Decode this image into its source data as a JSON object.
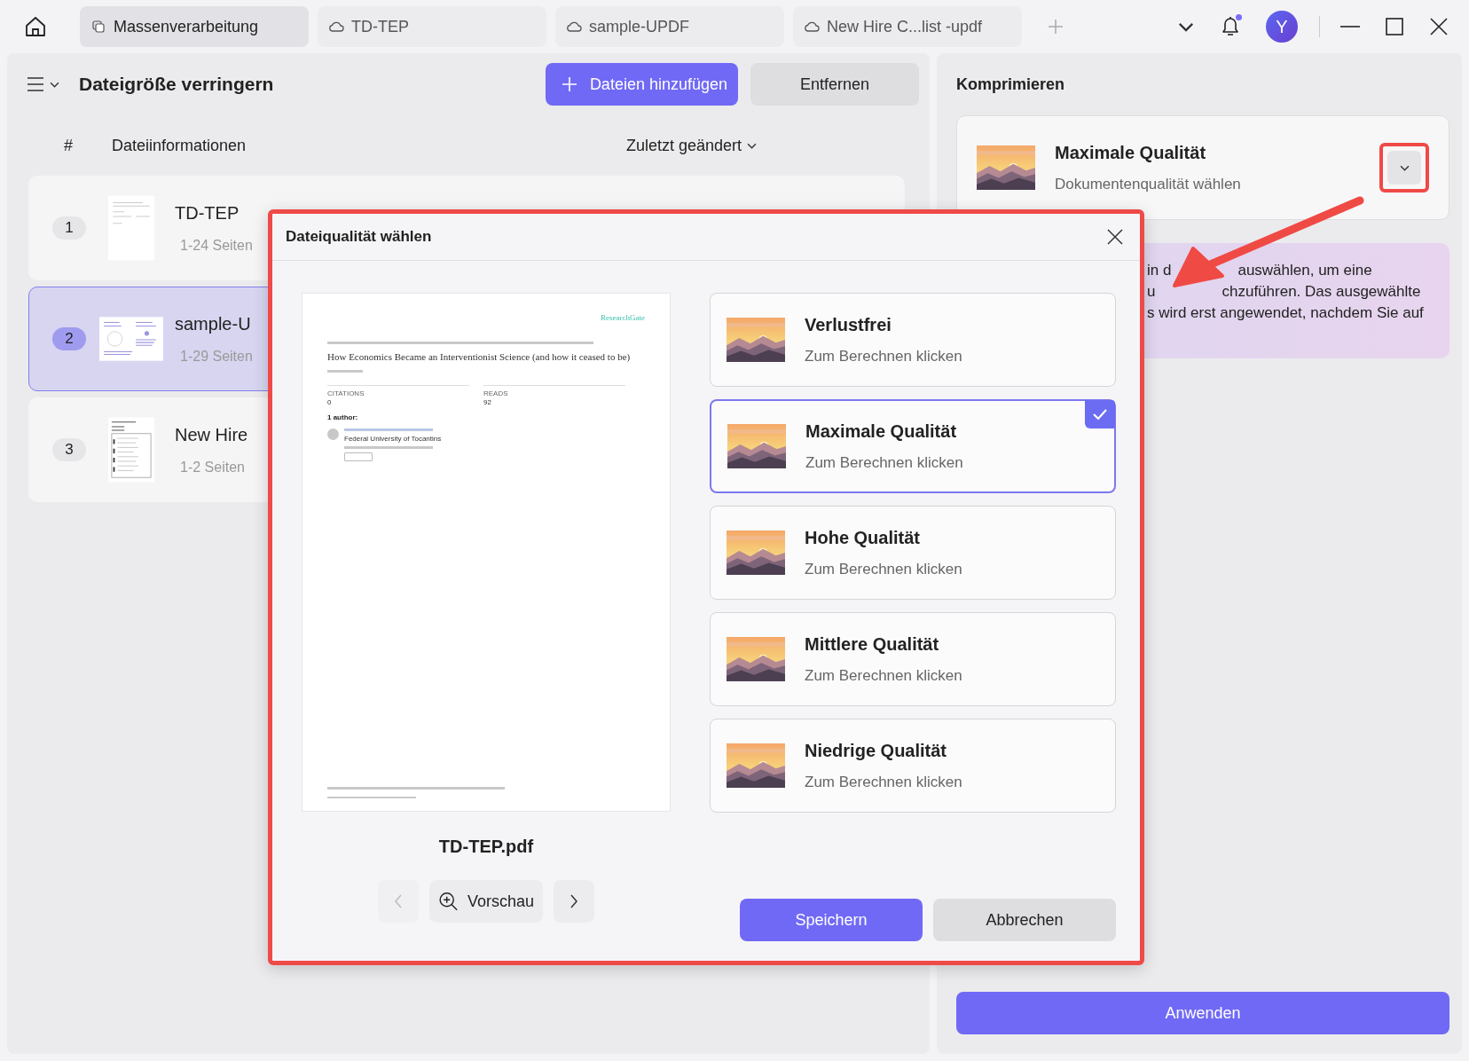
{
  "tabs": [
    {
      "label": "Massenverarbeitung",
      "kind": "local",
      "selected": true
    },
    {
      "label": "TD-TEP",
      "kind": "cloud",
      "selected": false
    },
    {
      "label": "sample-UPDF",
      "kind": "cloud",
      "selected": false
    },
    {
      "label": "New Hire C...list -updf",
      "kind": "cloud",
      "selected": false
    }
  ],
  "user": {
    "initial": "Y",
    "notification": true
  },
  "toolbar": {
    "title": "Dateigröße verringern",
    "add_button": "Dateien hinzufügen",
    "remove_button": "Entfernen"
  },
  "file_list": {
    "columns": [
      "#",
      "Dateiinformationen",
      "Zuletzt geändert"
    ],
    "files": [
      {
        "number": "1",
        "name": "TD-TEP",
        "pages": "1-24 Seiten",
        "kind": "portrait",
        "selected": false
      },
      {
        "number": "2",
        "name": "sample-U",
        "pages": "1-29 Seiten",
        "kind": "landscape",
        "selected": true
      },
      {
        "number": "3",
        "name": "New Hire",
        "pages": "1-2 Seiten",
        "kind": "form",
        "selected": false
      }
    ]
  },
  "compress_panel": {
    "title": "Komprimieren",
    "quality": "Maximale Qualität",
    "hint": "Dokumentenqualität wählen",
    "info_lines": [
      [
        "in d",
        "auswählen, um eine"
      ],
      [
        "u",
        "chzuführen. Das ausgewählte"
      ],
      [
        "s wird erst angewendet, nachdem Sie auf"
      ]
    ],
    "apply_button": "Anwenden"
  },
  "dialog": {
    "title": "Dateiqualität wählen",
    "preview": {
      "brand": "ResearchGate",
      "title": "How Economics Became an Interventionist Science (and how it ceased to be)",
      "stats": [
        {
          "label": "CITATIONS",
          "value": "0"
        },
        {
          "label": "READS",
          "value": "92"
        }
      ],
      "authors_label": "1 author:",
      "affiliation": "Federal University of Tocantins"
    },
    "file_name": "TD-TEP.pdf",
    "preview_button": "Vorschau",
    "prev_disabled": true,
    "options": [
      {
        "label": "Verlustfrei",
        "hint": "Zum Berechnen klicken",
        "selected": false
      },
      {
        "label": "Maximale Qualität",
        "hint": "Zum Berechnen klicken",
        "selected": true
      },
      {
        "label": "Hohe Qualität",
        "hint": "Zum Berechnen klicken",
        "selected": false
      },
      {
        "label": "Mittlere Qualität",
        "hint": "Zum Berechnen klicken",
        "selected": false
      },
      {
        "label": "Niedrige Qualität",
        "hint": "Zum Berechnen klicken",
        "selected": false
      }
    ],
    "save_button": "Speichern",
    "cancel_button": "Abbrechen"
  }
}
